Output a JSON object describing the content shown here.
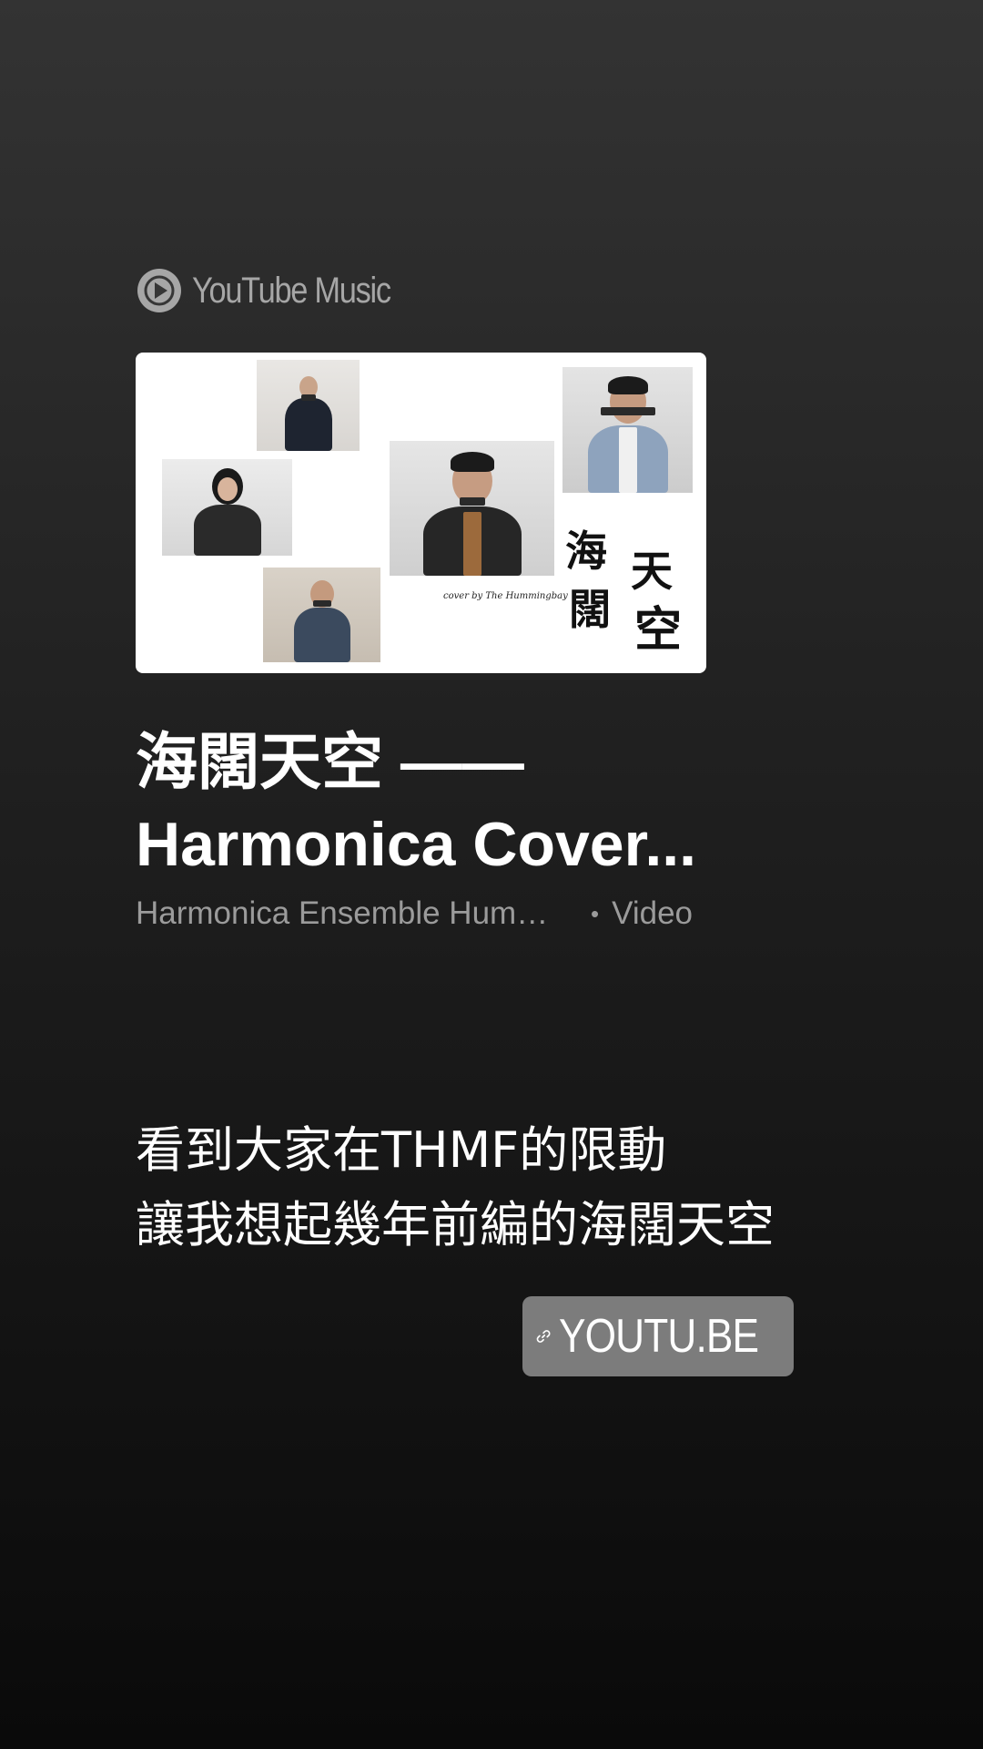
{
  "brand": {
    "label": "YouTube Music",
    "icon": "youtube-music-play-icon"
  },
  "thumbnail": {
    "calligraphy": [
      "海",
      "闊",
      "天",
      "空"
    ],
    "cover_credit": "cover by The Hummingbay"
  },
  "media": {
    "title_line1": "海闊天空 ——",
    "title_line2": "Harmonica Cover...",
    "channel": "Harmonica Ensemble Hummingbay",
    "separator": "•",
    "type": "Video"
  },
  "caption": {
    "line1": "看到大家在THMF的限動",
    "line2": "讓我想起幾年前編的海闊天空"
  },
  "link_sticker": {
    "icon": "link-icon",
    "label": "YOUTU.BE"
  },
  "colors": {
    "background_top": "#333333",
    "background_bottom": "#0a0a0a",
    "sticker_bg": "#7c7c7c",
    "meta_text": "#9b9b9b"
  }
}
